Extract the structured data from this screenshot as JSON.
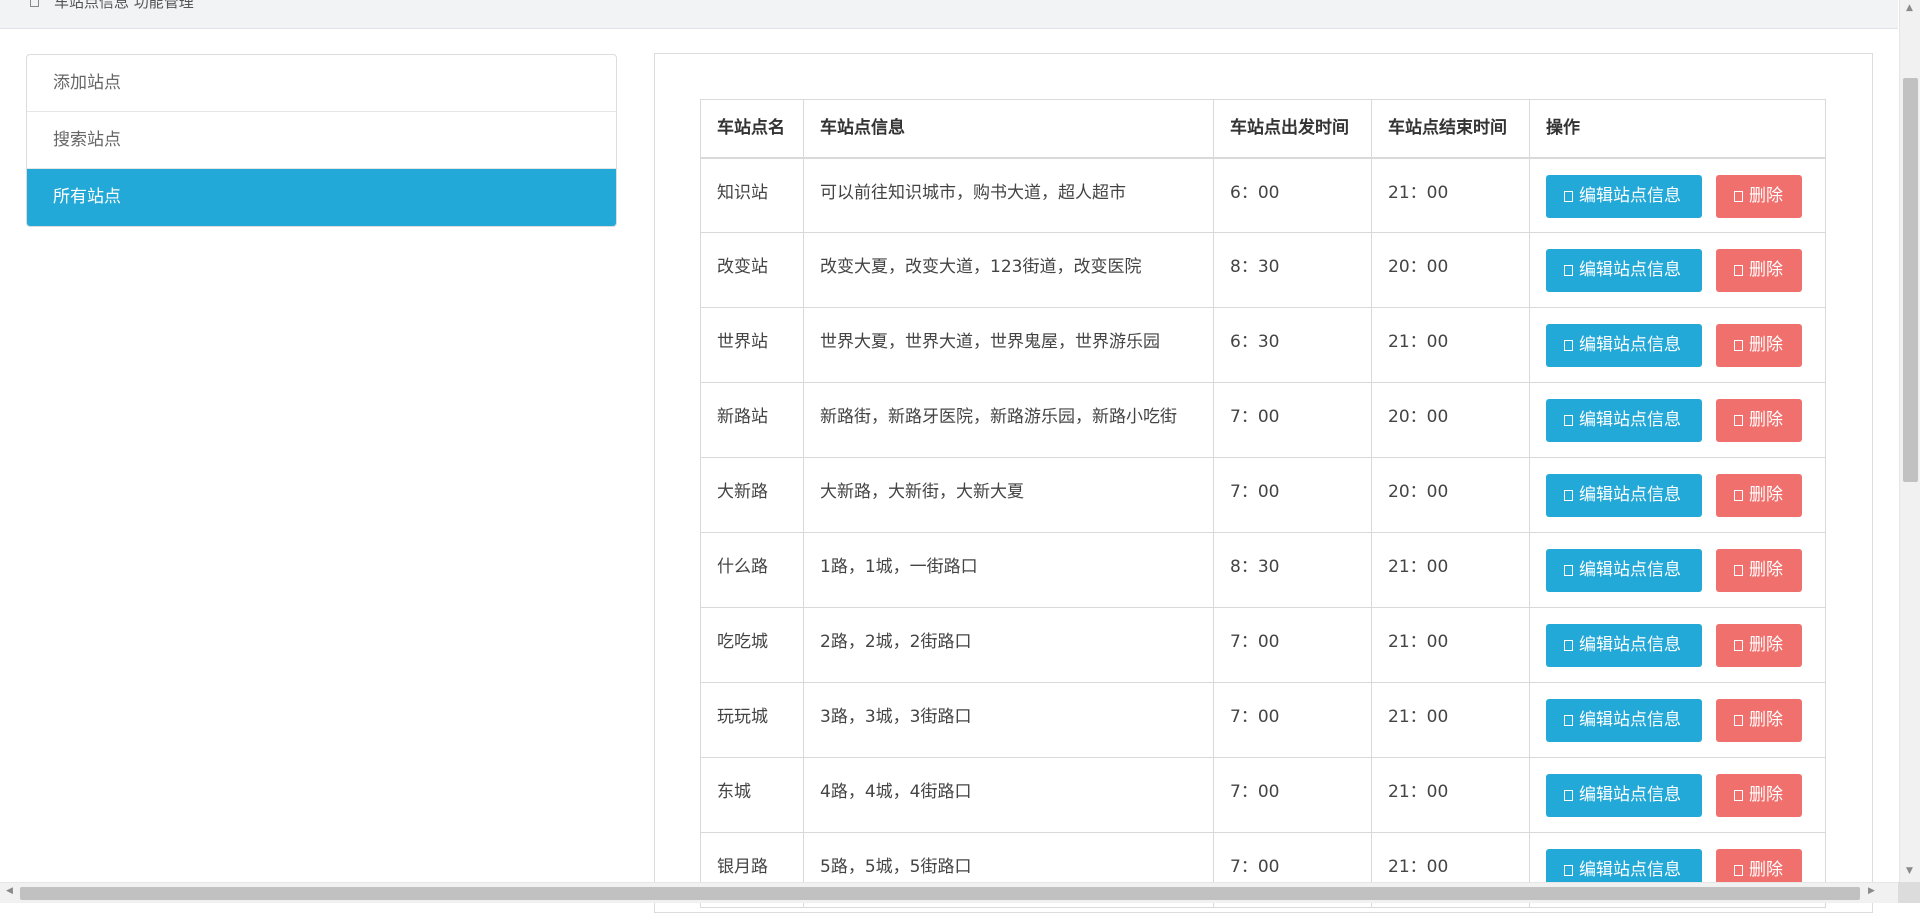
{
  "header": {
    "crumb": "车站点信息 功能管理"
  },
  "menu": {
    "items": [
      {
        "label": "添加站点"
      },
      {
        "label": "搜索站点"
      },
      {
        "label": "所有站点"
      }
    ]
  },
  "table": {
    "columns": [
      "车站点名",
      "车站点信息",
      "车站点出发时间",
      "车站点结束时间",
      "操作"
    ],
    "rows": [
      {
        "name": "知识站",
        "info": "可以前往知识城市，购书大道，超人超市",
        "start": "6：00",
        "end": "21：00"
      },
      {
        "name": "改变站",
        "info": "改变大夏，改变大道，123街道，改变医院",
        "start": "8：30",
        "end": "20：00"
      },
      {
        "name": "世界站",
        "info": "世界大夏，世界大道，世界鬼屋，世界游乐园",
        "start": "6：30",
        "end": "21：00"
      },
      {
        "name": "新路站",
        "info": "新路街，新路牙医院，新路游乐园，新路小吃街",
        "start": "7：00",
        "end": "20：00"
      },
      {
        "name": "大新路",
        "info": "大新路，大新街，大新大夏",
        "start": "7：00",
        "end": "20：00"
      },
      {
        "name": "什么路",
        "info": "1路，1城，一街路口",
        "start": "8：30",
        "end": "21：00"
      },
      {
        "name": "吃吃城",
        "info": "2路，2城，2街路口",
        "start": "7：00",
        "end": "21：00"
      },
      {
        "name": "玩玩城",
        "info": "3路，3城，3街路口",
        "start": "7：00",
        "end": "21：00"
      },
      {
        "name": "东城",
        "info": "4路，4城，4街路口",
        "start": "7：00",
        "end": "21：00"
      },
      {
        "name": "银月路",
        "info": "5路，5城，5街路口",
        "start": "7：00",
        "end": "21：00"
      }
    ],
    "edit_label": "编辑站点信息",
    "delete_label": "删除"
  },
  "colors": {
    "accent": "#23a9d8",
    "danger": "#f0706d"
  },
  "icons": {
    "edit": "edit-icon",
    "delete": "trash-icon"
  }
}
